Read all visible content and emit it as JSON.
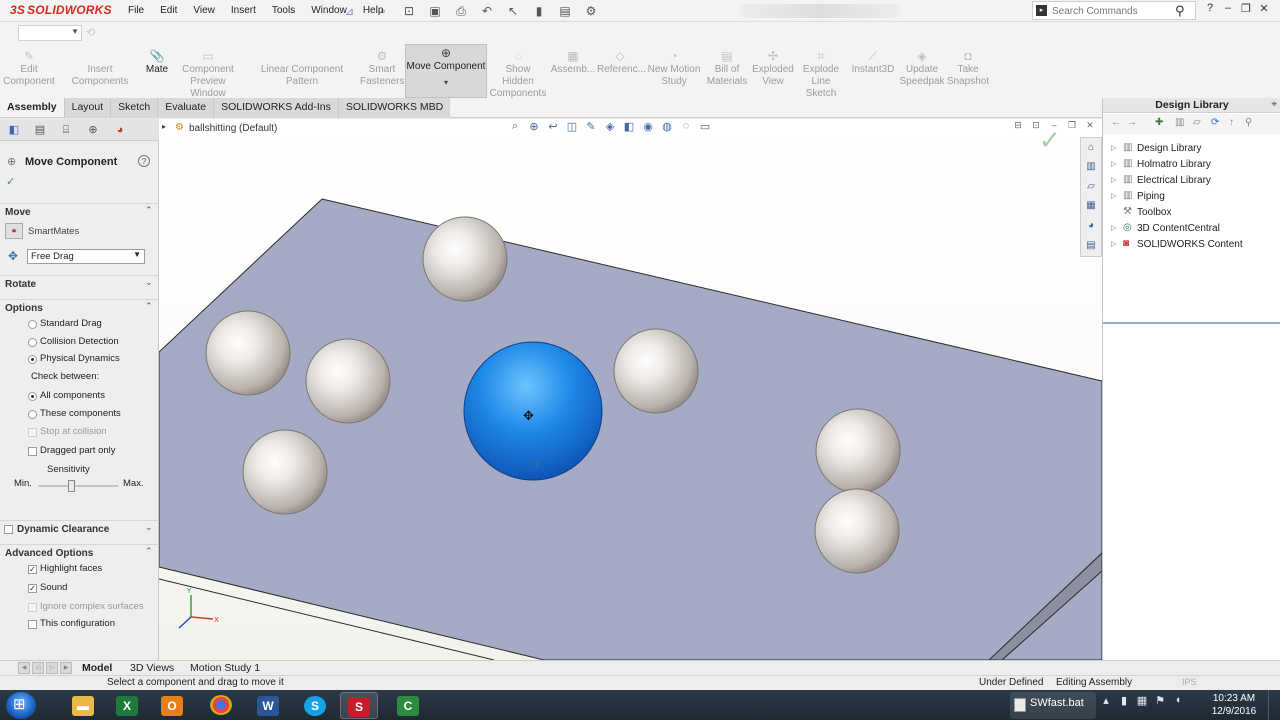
{
  "app": {
    "logo_prefix": "3S",
    "logo_text": "SOLIDWORKS",
    "menu": [
      "File",
      "Edit",
      "View",
      "Insert",
      "Tools",
      "Window",
      "Help"
    ],
    "search_placeholder": "Search Commands"
  },
  "command_manager": {
    "buttons": [
      {
        "label": "Edit Component",
        "icon": "edit-component-icon",
        "state": "disabled"
      },
      {
        "label": "Insert Components",
        "icon": "insert-components-icon",
        "state": "disabled"
      },
      {
        "label": "Mate",
        "icon": "mate-icon",
        "state": "enabled"
      },
      {
        "label": "Component Preview Window",
        "icon": "preview-window-icon",
        "state": "disabled"
      },
      {
        "label": "Linear Component Pattern",
        "icon": "linear-pattern-icon",
        "state": "disabled"
      },
      {
        "label": "Smart Fasteners",
        "icon": "smart-fasteners-icon",
        "state": "disabled"
      },
      {
        "label": "Move Component",
        "icon": "move-component-icon",
        "state": "pressed"
      },
      {
        "label": "Show Hidden Components",
        "icon": "show-hidden-icon",
        "state": "disabled"
      },
      {
        "label": "Assemb...",
        "icon": "assembly-features-icon",
        "state": "disabled"
      },
      {
        "label": "Referenc...",
        "icon": "reference-geometry-icon",
        "state": "disabled"
      },
      {
        "label": "New Motion Study",
        "icon": "motion-study-icon",
        "state": "disabled"
      },
      {
        "label": "Bill of Materials",
        "icon": "bom-icon",
        "state": "disabled"
      },
      {
        "label": "Exploded View",
        "icon": "exploded-view-icon",
        "state": "disabled"
      },
      {
        "label": "Explode Line Sketch",
        "icon": "explode-line-icon",
        "state": "disabled"
      },
      {
        "label": "Instant3D",
        "icon": "instant3d-icon",
        "state": "disabled"
      },
      {
        "label": "Update Speedpak",
        "icon": "speedpak-icon",
        "state": "disabled"
      },
      {
        "label": "Take Snapshot",
        "icon": "snapshot-icon",
        "state": "disabled"
      }
    ],
    "tabs": [
      "Assembly",
      "Layout",
      "Sketch",
      "Evaluate",
      "SOLIDWORKS Add-Ins",
      "SOLIDWORKS MBD"
    ],
    "selected_tab": "Assembly"
  },
  "property_manager": {
    "title": "Move Component",
    "move": {
      "heading": "Move",
      "smartmates_label": "SmartMates",
      "drag_mode": "Free Drag"
    },
    "rotate": {
      "heading": "Rotate"
    },
    "options": {
      "heading": "Options",
      "standard_drag": "Standard Drag",
      "collision_detection": "Collision Detection",
      "physical_dynamics": "Physical Dynamics",
      "selected_mode": "Physical Dynamics",
      "check_between": "Check between:",
      "all_components": "All components",
      "these_components": "These components",
      "selected_check": "All components",
      "stop_at_collision": "Stop at collision",
      "dragged_part_only": "Dragged part only",
      "sensitivity": "Sensitivity",
      "min_label": "Min.",
      "max_label": "Max.",
      "sensitivity_level": 0.42
    },
    "dynamic_clearance": {
      "heading": "Dynamic Clearance",
      "checked": false
    },
    "advanced_options": {
      "heading": "Advanced Options",
      "highlight_faces": "Highlight faces",
      "highlight_faces_checked": true,
      "sound": "Sound",
      "sound_checked": true,
      "ignore_complex": "Ignore complex surfaces",
      "ignore_complex_checked": false,
      "this_configuration": "This configuration",
      "this_configuration_checked": false
    }
  },
  "graphics": {
    "assembly_name": "ballshitting  (Default)",
    "selected_color": "#1a6fdb",
    "ball_color": "#e2ddd9",
    "plate_color": "#a5abc4"
  },
  "design_library": {
    "title": "Design Library",
    "items": [
      {
        "label": "Design Library",
        "icon": "folder-icon"
      },
      {
        "label": "Holmatro Library",
        "icon": "folder-icon"
      },
      {
        "label": "Electrical Library",
        "icon": "folder-icon"
      },
      {
        "label": "Piping",
        "icon": "folder-icon"
      },
      {
        "label": "Toolbox",
        "icon": "toolbox-icon"
      },
      {
        "label": "3D ContentCentral",
        "icon": "globe-icon"
      },
      {
        "label": "SOLIDWORKS Content",
        "icon": "solidworks-content-icon"
      }
    ]
  },
  "model_tabs": [
    "Model",
    "3D Views",
    "Motion Study 1"
  ],
  "status_bar": {
    "message": "Select a component and drag to move it",
    "state": "Under Defined",
    "mode": "Editing Assembly",
    "units": "IPS"
  },
  "taskbar": {
    "running_task": "SWfast.bat",
    "clock_time": "10:23 AM",
    "clock_date": "12/9/2016",
    "apps": [
      "Windows Explorer",
      "Outlook",
      "Excel",
      "Chrome",
      "Word",
      "Skype",
      "SOLIDWORKS 2017",
      "Camtasia"
    ]
  }
}
